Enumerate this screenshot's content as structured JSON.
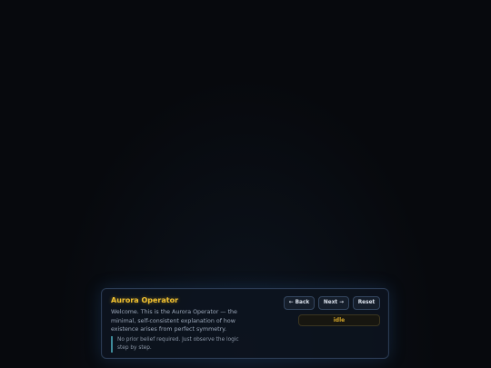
{
  "panel": {
    "title": "Aurora Operator",
    "body": "Welcome. This is the Aurora Operator — the minimal, self-consistent explanation of how existence arises from perfect symmetry.",
    "note": "No prior belief required. Just observe the logic step by step."
  },
  "controls": {
    "back_label": "← Back",
    "next_label": "Next →",
    "reset_label": "Reset",
    "status": "idle"
  },
  "colors": {
    "background": "#07090d",
    "title_accent": "#f2c230",
    "note_border": "#3f8b9a",
    "status_text": "#d4a62a"
  }
}
